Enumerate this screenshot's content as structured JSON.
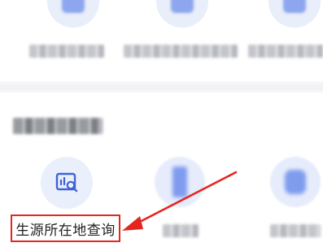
{
  "service_grid": {
    "featured_item": {
      "label": "生源所在地查询",
      "icon": "chart-search-icon"
    }
  },
  "annotation": {
    "highlight_color": "#e5261e",
    "arrow_color": "#e5261e"
  },
  "colors": {
    "icon_bg": "#eaeffc",
    "icon_accent": "#3f63d8"
  }
}
